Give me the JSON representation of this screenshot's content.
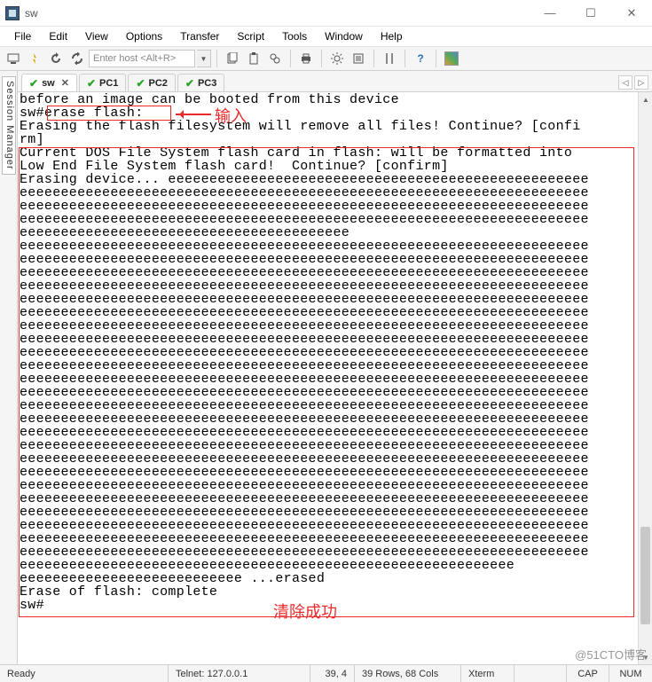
{
  "window": {
    "title": "sw",
    "buttons": {
      "min": "—",
      "max": "☐",
      "close": "✕"
    }
  },
  "menu": [
    "File",
    "Edit",
    "View",
    "Options",
    "Transfer",
    "Script",
    "Tools",
    "Window",
    "Help"
  ],
  "toolbar": {
    "host_placeholder": "Enter host <Alt+R>"
  },
  "session_manager_label": "Session Manager",
  "tabs": [
    {
      "label": "sw",
      "active": true,
      "closeable": true
    },
    {
      "label": "PC1",
      "active": false,
      "closeable": false
    },
    {
      "label": "PC2",
      "active": false,
      "closeable": false
    },
    {
      "label": "PC3",
      "active": false,
      "closeable": false
    }
  ],
  "terminal_lines": [
    "before an image can be booted from this device",
    "sw#erase flash:",
    "Erasing the flash filesystem will remove all files! Continue? [confi",
    "rm]",
    "Current DOS File System flash card in flash: will be formatted into",
    "Low End File System flash card!  Continue? [confirm]",
    "Erasing device... eeeeeeeeeeeeeeeeeeeeeeeeeeeeeeeeeeeeeeeeeeeeeeeeeee",
    "eeeeeeeeeeeeeeeeeeeeeeeeeeeeeeeeeeeeeeeeeeeeeeeeeeeeeeeeeeeeeeeeeeeee",
    "eeeeeeeeeeeeeeeeeeeeeeeeeeeeeeeeeeeeeeeeeeeeeeeeeeeeeeeeeeeeeeeeeeeee",
    "eeeeeeeeeeeeeeeeeeeeeeeeeeeeeeeeeeeeeeeeeeeeeeeeeeeeeeeeeeeeeeeeeeeee",
    "eeeeeeeeeeeeeeeeeeeeeeeeeeeeeeeeeeeeeeee",
    "eeeeeeeeeeeeeeeeeeeeeeeeeeeeeeeeeeeeeeeeeeeeeeeeeeeeeeeeeeeeeeeeeeeee",
    "eeeeeeeeeeeeeeeeeeeeeeeeeeeeeeeeeeeeeeeeeeeeeeeeeeeeeeeeeeeeeeeeeeeee",
    "eeeeeeeeeeeeeeeeeeeeeeeeeeeeeeeeeeeeeeeeeeeeeeeeeeeeeeeeeeeeeeeeeeeee",
    "eeeeeeeeeeeeeeeeeeeeeeeeeeeeeeeeeeeeeeeeeeeeeeeeeeeeeeeeeeeeeeeeeeeee",
    "eeeeeeeeeeeeeeeeeeeeeeeeeeeeeeeeeeeeeeeeeeeeeeeeeeeeeeeeeeeeeeeeeeeee",
    "eeeeeeeeeeeeeeeeeeeeeeeeeeeeeeeeeeeeeeeeeeeeeeeeeeeeeeeeeeeeeeeeeeeee",
    "eeeeeeeeeeeeeeeeeeeeeeeeeeeeeeeeeeeeeeeeeeeeeeeeeeeeeeeeeeeeeeeeeeeee",
    "eeeeeeeeeeeeeeeeeeeeeeeeeeeeeeeeeeeeeeeeeeeeeeeeeeeeeeeeeeeeeeeeeeeee",
    "eeeeeeeeeeeeeeeeeeeeeeeeeeeeeeeeeeeeeeeeeeeeeeeeeeeeeeeeeeeeeeeeeeeee",
    "eeeeeeeeeeeeeeeeeeeeeeeeeeeeeeeeeeeeeeeeeeeeeeeeeeeeeeeeeeeeeeeeeeeee",
    "eeeeeeeeeeeeeeeeeeeeeeeeeeeeeeeeeeeeeeeeeeeeeeeeeeeeeeeeeeeeeeeeeeeee",
    "eeeeeeeeeeeeeeeeeeeeeeeeeeeeeeeeeeeeeeeeeeeeeeeeeeeeeeeeeeeeeeeeeeeee",
    "eeeeeeeeeeeeeeeeeeeeeeeeeeeeeeeeeeeeeeeeeeeeeeeeeeeeeeeeeeeeeeeeeeeee",
    "eeeeeeeeeeeeeeeeeeeeeeeeeeeeeeeeeeeeeeeeeeeeeeeeeeeeeeeeeeeeeeeeeeeee",
    "eeeeeeeeeeeeeeeeeeeeeeeeeeeeeeeeeeeeeeeeeeeeeeeeeeeeeeeeeeeeeeeeeeeee",
    "eeeeeeeeeeeeeeeeeeeeeeeeeeeeeeeeeeeeeeeeeeeeeeeeeeeeeeeeeeeeeeeeeeeee",
    "eeeeeeeeeeeeeeeeeeeeeeeeeeeeeeeeeeeeeeeeeeeeeeeeeeeeeeeeeeeeeeeeeeeee",
    "eeeeeeeeeeeeeeeeeeeeeeeeeeeeeeeeeeeeeeeeeeeeeeeeeeeeeeeeeeeeeeeeeeeee",
    "eeeeeeeeeeeeeeeeeeeeeeeeeeeeeeeeeeeeeeeeeeeeeeeeeeeeeeeeeeeeeeeeeeeee",
    "eeeeeeeeeeeeeeeeeeeeeeeeeeeeeeeeeeeeeeeeeeeeeeeeeeeeeeeeeeeeeeeeeeeee",
    "eeeeeeeeeeeeeeeeeeeeeeeeeeeeeeeeeeeeeeeeeeeeeeeeeeeeeeeeeeeeeeeeeeeee",
    "eeeeeeeeeeeeeeeeeeeeeeeeeeeeeeeeeeeeeeeeeeeeeeeeeeeeeeeeeeeeeeeeeeeee",
    "eeeeeeeeeeeeeeeeeeeeeeeeeeeeeeeeeeeeeeeeeeeeeeeeeeeeeeeeeeeeeeeeeeeee",
    "eeeeeeeeeeeeeeeeeeeeeeeeeeeeeeeeeeeeeeeeeeeeeeeeeeeeeeeeeeeeeeeeeeeee",
    "eeeeeeeeeeeeeeeeeeeeeeeeeeeeeeeeeeeeeeeeeeeeeeeeeeeeeeeeeeee",
    "eeeeeeeeeeeeeeeeeeeeeeeeeee ...erased",
    "Erase of flash: complete",
    "sw#"
  ],
  "annotations": {
    "input_label": "输入",
    "success_label": "清除成功"
  },
  "status": {
    "state": "Ready",
    "telnet": "Telnet: 127.0.0.1",
    "cursor": "39,  4",
    "dim": "39 Rows, 68 Cols",
    "term": "Xterm",
    "cap": "CAP",
    "num": "NUM"
  },
  "watermark": "@51CTO博客"
}
